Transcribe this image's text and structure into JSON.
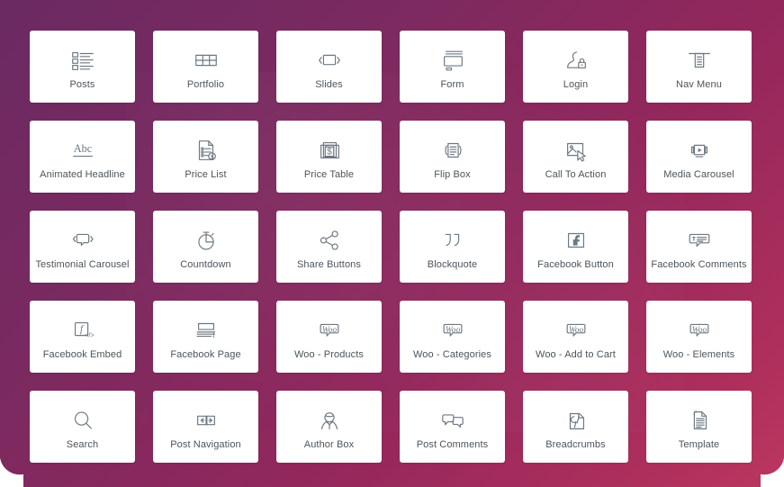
{
  "page": {
    "background_gradient_from": "#6b2a62",
    "background_gradient_to": "#bb3760",
    "card_background": "#ffffff",
    "label_color": "#4b545c",
    "icon_color": "#6d7882",
    "columns": 6,
    "rows": 5
  },
  "widgets": [
    {
      "label": "Posts",
      "icon": "posts-icon"
    },
    {
      "label": "Portfolio",
      "icon": "portfolio-icon"
    },
    {
      "label": "Slides",
      "icon": "slides-icon"
    },
    {
      "label": "Form",
      "icon": "form-icon"
    },
    {
      "label": "Login",
      "icon": "login-icon"
    },
    {
      "label": "Nav Menu",
      "icon": "nav-menu-icon"
    },
    {
      "label": "Animated Headline",
      "icon": "animated-headline-icon"
    },
    {
      "label": "Price List",
      "icon": "price-list-icon"
    },
    {
      "label": "Price Table",
      "icon": "price-table-icon"
    },
    {
      "label": "Flip Box",
      "icon": "flip-box-icon"
    },
    {
      "label": "Call To Action",
      "icon": "call-to-action-icon"
    },
    {
      "label": "Media Carousel",
      "icon": "media-carousel-icon"
    },
    {
      "label": "Testimonial Carousel",
      "icon": "testimonial-carousel-icon"
    },
    {
      "label": "Countdown",
      "icon": "countdown-icon"
    },
    {
      "label": "Share Buttons",
      "icon": "share-buttons-icon"
    },
    {
      "label": "Blockquote",
      "icon": "blockquote-icon"
    },
    {
      "label": "Facebook Button",
      "icon": "facebook-button-icon"
    },
    {
      "label": "Facebook Comments",
      "icon": "facebook-comments-icon"
    },
    {
      "label": "Facebook Embed",
      "icon": "facebook-embed-icon"
    },
    {
      "label": "Facebook Page",
      "icon": "facebook-page-icon"
    },
    {
      "label": "Woo - Products",
      "icon": "woo-products-icon"
    },
    {
      "label": "Woo - Categories",
      "icon": "woo-categories-icon"
    },
    {
      "label": "Woo - Add to Cart",
      "icon": "woo-add-to-cart-icon"
    },
    {
      "label": "Woo - Elements",
      "icon": "woo-elements-icon"
    },
    {
      "label": "Search",
      "icon": "search-icon"
    },
    {
      "label": "Post Navigation",
      "icon": "post-navigation-icon"
    },
    {
      "label": "Author Box",
      "icon": "author-box-icon"
    },
    {
      "label": "Post Comments",
      "icon": "post-comments-icon"
    },
    {
      "label": "Breadcrumbs",
      "icon": "breadcrumbs-icon"
    },
    {
      "label": "Template",
      "icon": "template-icon"
    }
  ],
  "icon_glyph_text": {
    "animated-headline-icon": "Abc",
    "price-list-icon": "$",
    "price-table-icon": "$",
    "facebook-embed-icon": "f",
    "facebook-embed-code": "</>",
    "facebook-comments-icon": "f",
    "facebook-page-icon": "f",
    "woo-label": "Woo",
    "breadcrumbs-icon": "y"
  }
}
